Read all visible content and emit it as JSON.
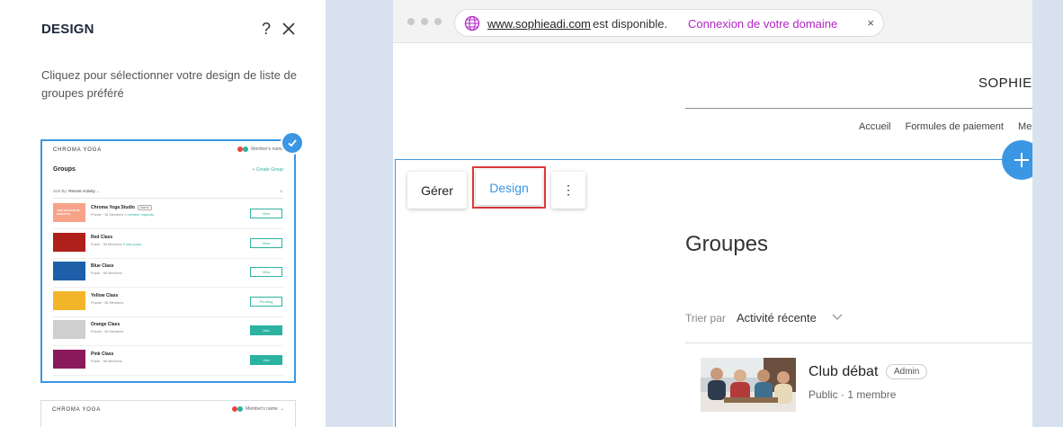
{
  "panel": {
    "title": "DESIGN",
    "help": "?",
    "description": "Cliquez pour sélectionner votre design de liste de groupes préféré"
  },
  "preview": {
    "logo": "CHROMA YOGA",
    "user_label": "Member's name",
    "groups_label": "Groups",
    "create_label": "+ Create Group",
    "sort_label": "Sort By:",
    "sort_value": "Recent Activity",
    "admin_badge": "Admin",
    "rows": [
      {
        "name": "Chroma Yoga Studio",
        "meta": "Private · 34 Members",
        "extra": "2 member requests",
        "button": "View",
        "thumb": "#f6a38a",
        "thumb_text": "LIKE SECTION OF BENEFITS"
      },
      {
        "name": "Red Class",
        "meta": "Public · 56 Members",
        "extra": "3 new posts",
        "button": "View",
        "thumb": "#b0201a"
      },
      {
        "name": "Blue Class",
        "meta": "Public · 56 Members",
        "extra": "",
        "button": "View",
        "thumb": "#1d5fa8"
      },
      {
        "name": "Yellow Class",
        "meta": "Private · 56 Members",
        "extra": "",
        "button": "Pending",
        "thumb": "#f2b52a"
      },
      {
        "name": "Orange Class",
        "meta": "Private · 56 Members",
        "extra": "",
        "button": "Join",
        "thumb": "#cfcfcf"
      },
      {
        "name": "Pink Class",
        "meta": "Public · 56 Members",
        "extra": "",
        "button": "Join",
        "thumb": "#8b1a5c"
      }
    ]
  },
  "browser": {
    "domain": "www.sophieadi.com",
    "availability": "est disponible.",
    "connect_label": "Connexion de votre domaine",
    "close": "×"
  },
  "site": {
    "title": "SOPHIE",
    "nav": [
      "Accueil",
      "Formules de paiement",
      "Me"
    ]
  },
  "toolbar": {
    "manage": "Gérer",
    "design": "Design",
    "more": "⋮"
  },
  "groups": {
    "title": "Groupes",
    "sort_label": "Trier par",
    "sort_value": "Activité récente",
    "club_name": "Club débat",
    "club_badge": "Admin",
    "club_meta": "Public · 1 membre"
  },
  "colors": {
    "accent": "#3b97e3",
    "connect": "#b325c6",
    "highlight": "#e0383a",
    "teal": "#2bb3a0"
  }
}
